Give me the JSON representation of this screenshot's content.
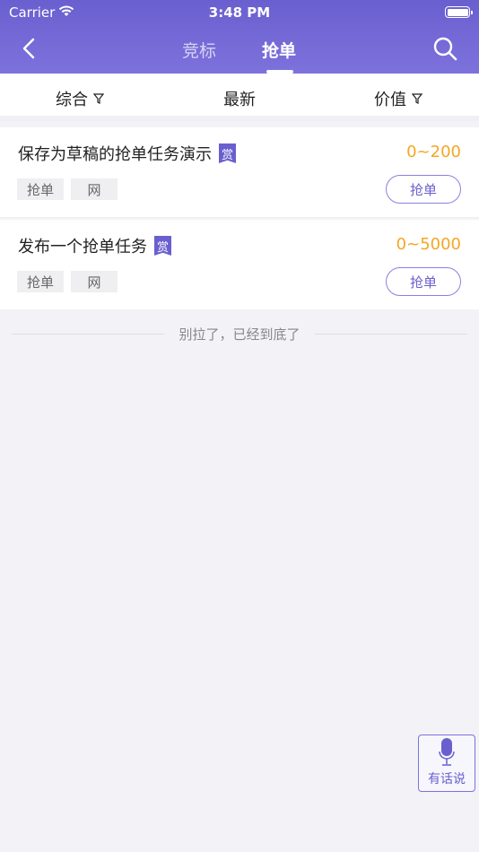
{
  "status_bar": {
    "carrier": "Carrier",
    "time": "3:48 PM"
  },
  "nav": {
    "tabs": [
      "竞标",
      "抢单"
    ],
    "active_tab": "抢单"
  },
  "filters": [
    {
      "label": "综合",
      "has_filter_icon": true
    },
    {
      "label": "最新",
      "has_filter_icon": false
    },
    {
      "label": "价值",
      "has_filter_icon": true
    }
  ],
  "tasks": [
    {
      "title": "保存为草稿的抢单任务演示",
      "badge": "赏",
      "price": "0~200",
      "tags": [
        "抢单",
        "网"
      ],
      "action": "抢单"
    },
    {
      "title": "发布一个抢单任务",
      "badge": "赏",
      "price": "0~5000",
      "tags": [
        "抢单",
        "网"
      ],
      "action": "抢单"
    }
  ],
  "end_message": "别拉了，已经到底了",
  "feedback_button": {
    "label": "有话说",
    "icon": "mic-icon"
  },
  "colors": {
    "primary": "#6a5fcf",
    "price": "#f5a623"
  }
}
